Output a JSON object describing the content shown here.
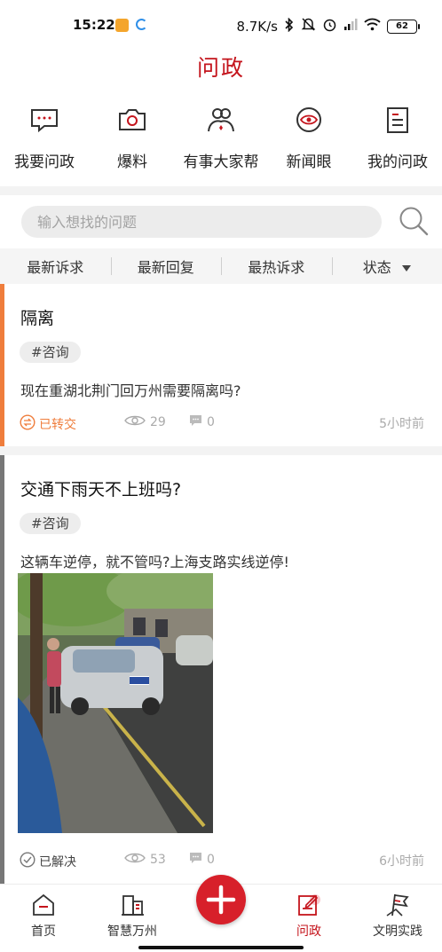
{
  "status_bar": {
    "time": "15:22",
    "network_speed": "8.7K/s",
    "battery": "62",
    "icons": [
      "notification-app-icon",
      "loading-app-icon",
      "bluetooth-icon",
      "mute-icon",
      "alarm-icon",
      "signal-icon",
      "wifi-icon",
      "battery-icon"
    ]
  },
  "header": {
    "title": "问政"
  },
  "quick_actions": [
    {
      "label": "我要问政",
      "icon": "message-dots-icon"
    },
    {
      "label": "爆料",
      "icon": "camera-icon"
    },
    {
      "label": "有事大家帮",
      "icon": "people-icon"
    },
    {
      "label": "新闻眼",
      "icon": "eye-icon"
    },
    {
      "label": "我的问政",
      "icon": "document-icon"
    }
  ],
  "search": {
    "placeholder": "输入想找的问题",
    "icon": "search-icon"
  },
  "filters": [
    {
      "label": "最新诉求"
    },
    {
      "label": "最新回复"
    },
    {
      "label": "最热诉求"
    },
    {
      "label": "状态",
      "icon": "caret-down-icon"
    }
  ],
  "posts": [
    {
      "title": "隔离",
      "tag": "#咨询",
      "content": "现在重湖北荆门回万州需要隔离吗?",
      "status": "已转交",
      "views": "29",
      "comments": "0",
      "time": "5小时前",
      "colors": {
        "accent": "#ef7d3c",
        "status": "#ef7d3c"
      }
    },
    {
      "title": "交通下雨天不上班吗?",
      "tag": "#咨询",
      "content": "这辆车逆停，就不管吗?上海支路实线逆停!",
      "status": "已解决",
      "views": "53",
      "comments": "0",
      "time": "6小时前",
      "colors": {
        "accent": "#777777",
        "status": "#444444"
      }
    }
  ],
  "bottom_nav": [
    {
      "label": "首页",
      "icon": "home-icon"
    },
    {
      "label": "智慧万州",
      "icon": "building-icon"
    },
    {
      "label": "问政",
      "icon": "edit-note-icon",
      "active": true
    },
    {
      "label": "文明实践",
      "icon": "flag-icon"
    }
  ],
  "fab": {
    "icon": "plus-icon"
  },
  "colors": {
    "brand": "#c4141c",
    "fab": "#d7202a",
    "muted": "#aaaaaa"
  }
}
